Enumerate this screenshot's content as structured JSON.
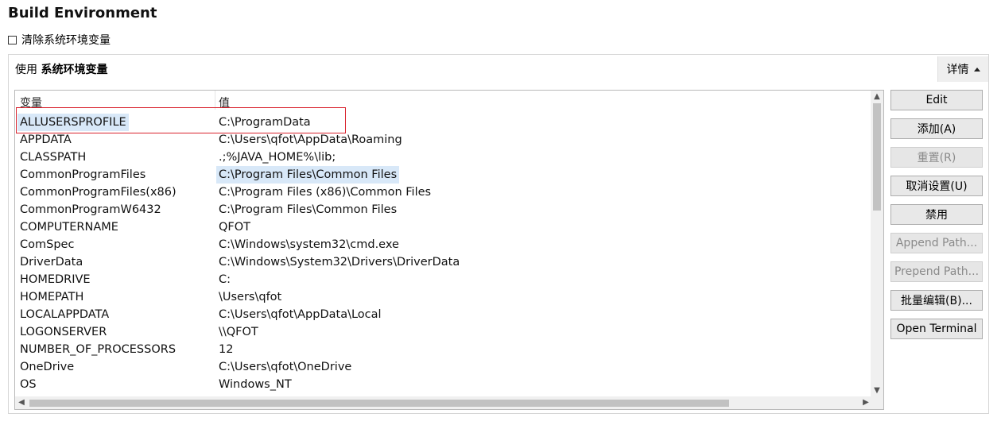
{
  "title": "Build Environment",
  "clear_env_label": "清除系统环境变量",
  "panel": {
    "header_prefix": "使用",
    "header_bold": "系统环境变量",
    "details_label": "详情"
  },
  "table": {
    "headers": [
      "变量",
      "值"
    ],
    "rows": [
      {
        "name": "ALLUSERSPROFILE",
        "value": "C:\\ProgramData"
      },
      {
        "name": "APPDATA",
        "value": "C:\\Users\\qfot\\AppData\\Roaming"
      },
      {
        "name": "CLASSPATH",
        "value": ".;%JAVA_HOME%\\lib;"
      },
      {
        "name": "CommonProgramFiles",
        "value": "C:\\Program Files\\Common Files"
      },
      {
        "name": "CommonProgramFiles(x86)",
        "value": "C:\\Program Files (x86)\\Common Files"
      },
      {
        "name": "CommonProgramW6432",
        "value": "C:\\Program Files\\Common Files"
      },
      {
        "name": "COMPUTERNAME",
        "value": "QFOT"
      },
      {
        "name": "ComSpec",
        "value": "C:\\Windows\\system32\\cmd.exe"
      },
      {
        "name": "DriverData",
        "value": "C:\\Windows\\System32\\Drivers\\DriverData"
      },
      {
        "name": "HOMEDRIVE",
        "value": "C:"
      },
      {
        "name": "HOMEPATH",
        "value": "\\Users\\qfot"
      },
      {
        "name": "LOCALAPPDATA",
        "value": "C:\\Users\\qfot\\AppData\\Local"
      },
      {
        "name": "LOGONSERVER",
        "value": "\\\\QFOT"
      },
      {
        "name": "NUMBER_OF_PROCESSORS",
        "value": "12"
      },
      {
        "name": "OneDrive",
        "value": "C:\\Users\\qfot\\OneDrive"
      },
      {
        "name": "OS",
        "value": "Windows_NT"
      }
    ]
  },
  "buttons": [
    {
      "label": "Edit",
      "enabled": true
    },
    {
      "label": "添加(A)",
      "enabled": true
    },
    {
      "label": "重置(R)",
      "enabled": false
    },
    {
      "label": "取消设置(U)",
      "enabled": true
    },
    {
      "label": "禁用",
      "enabled": true
    },
    {
      "label": "Append Path...",
      "enabled": false
    },
    {
      "label": "Prepend Path...",
      "enabled": false
    },
    {
      "label": "批量编辑(B)...",
      "enabled": true
    },
    {
      "label": "Open Terminal",
      "enabled": true
    }
  ]
}
